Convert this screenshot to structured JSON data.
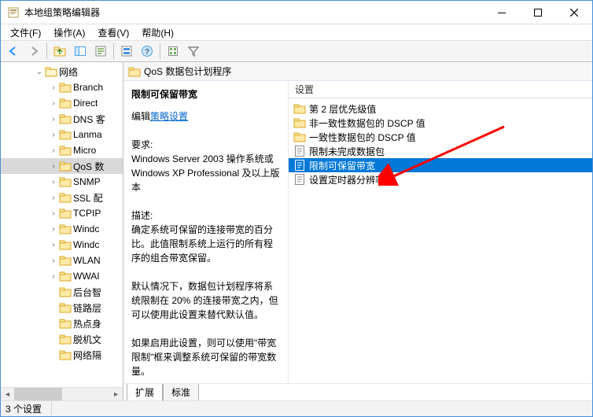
{
  "titlebar": {
    "title": "本地组策略编辑器"
  },
  "menubar": {
    "file": "文件(F)",
    "action": "操作(A)",
    "view": "查看(V)",
    "help": "帮助(H)"
  },
  "toolbar_icons": {
    "back": "back-arrow-icon",
    "forward": "forward-arrow-icon",
    "up": "up-folder-icon",
    "show": "show-pane-icon",
    "props": "properties-icon",
    "refresh": "refresh-icon",
    "help": "help-icon",
    "export": "export-icon",
    "filter": "filter-icon"
  },
  "tree": {
    "root": "网络",
    "items": [
      "Branch",
      "Direct",
      "DNS 客",
      "Lanma",
      "Micro",
      "QoS 数",
      "SNMP",
      "SSL 配",
      "TCPIP",
      "Windc",
      "Windc",
      "WLAN",
      "WWAI",
      "后台智",
      "链路层",
      "热点身",
      "脱机文",
      "网络隔"
    ],
    "selected_index": 5
  },
  "right": {
    "header": "QoS 数据包计划程序",
    "detail": {
      "name": "限制可保留带宽",
      "edit_prefix": "编辑",
      "edit_link": "策略设置",
      "req_label": "要求:",
      "req_text": "Windows Server 2003 操作系统或 Windows XP Professional 及以上版本",
      "desc_label": "描述:",
      "desc1": "确定系统可保留的连接带宽的百分比。此值限制系统上运行的所有程序的组合带宽保留。",
      "desc2": "默认情况下，数据包计划程序将系统限制在 20% 的连接带宽之内，但可以使用此设置来替代默认值。",
      "desc3": "如果启用此设置，则可以使用\"带宽限制\"框来调整系统可保留的带宽数量。"
    },
    "list": {
      "header": "设置",
      "items": [
        {
          "icon": "folder",
          "label": "第 2 层优先级值"
        },
        {
          "icon": "folder",
          "label": "非一致性数据包的 DSCP 值"
        },
        {
          "icon": "folder",
          "label": "一致性数据包的 DSCP 值"
        },
        {
          "icon": "setting",
          "label": "限制未完成数据包"
        },
        {
          "icon": "setting",
          "label": "限制可保留带宽"
        },
        {
          "icon": "setting",
          "label": "设置定时器分辨率"
        }
      ],
      "selected_index": 4
    },
    "tabs": {
      "extended": "扩展",
      "standard": "标准"
    }
  },
  "status": {
    "text": "3 个设置"
  }
}
